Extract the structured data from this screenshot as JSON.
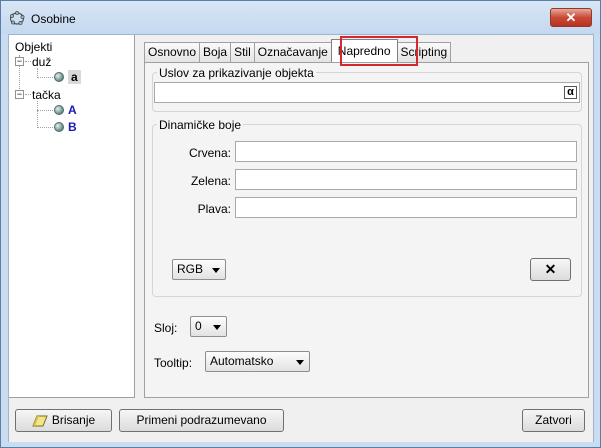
{
  "window": {
    "title": "Osobine",
    "close_label": "✕"
  },
  "tree": {
    "root": "Objekti",
    "groups": [
      {
        "label": "duž",
        "items": [
          {
            "label": "a"
          }
        ]
      },
      {
        "label": "tačka",
        "items": [
          {
            "label": "A"
          },
          {
            "label": "B"
          }
        ]
      }
    ]
  },
  "tabs": [
    "Osnovno",
    "Boja",
    "Stil",
    "Označavanje",
    "Napredno",
    "Scripting"
  ],
  "active_tab": "Napredno",
  "condition": {
    "title": "Uslov za prikazivanje objekta",
    "value": "",
    "alpha_label": "α"
  },
  "dynamic_colors": {
    "title": "Dinamičke boje",
    "fields": [
      {
        "label": "Crvena:",
        "value": ""
      },
      {
        "label": "Zelena:",
        "value": ""
      },
      {
        "label": "Plava:",
        "value": ""
      }
    ],
    "mode": "RGB",
    "clear_label": "✕"
  },
  "layer": {
    "label": "Sloj:",
    "value": "0"
  },
  "tooltip": {
    "label": "Tooltip:",
    "value": "Automatsko"
  },
  "footer": {
    "delete_label": "Brisanje",
    "defaults_label": "Primeni podrazumevano",
    "close_label": "Zatvori"
  },
  "colors": {
    "highlight": "#d6262e",
    "object_blue": "#1a1ab4"
  }
}
